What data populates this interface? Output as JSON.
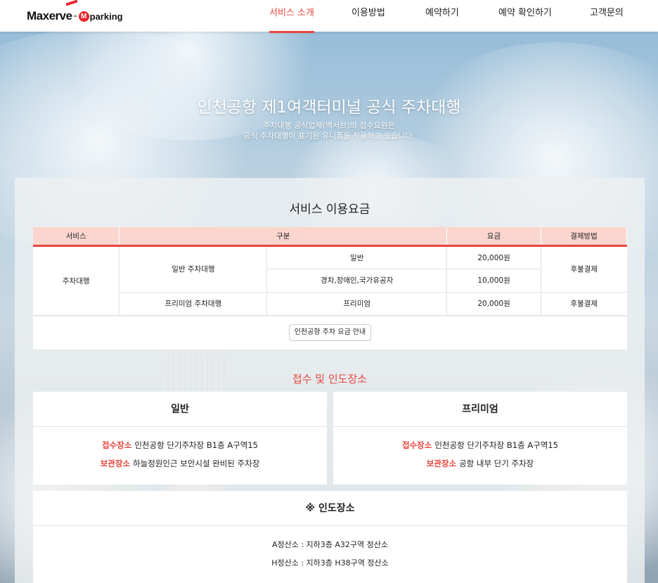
{
  "brand": {
    "logo_maxerve": "Maxerve",
    "logo_dash": "-",
    "logo_m": "M",
    "logo_parking": "parking"
  },
  "nav": {
    "items": [
      {
        "label": "서비스 소개"
      },
      {
        "label": "이용방법"
      },
      {
        "label": "예약하기"
      },
      {
        "label": "예약 확인하기"
      },
      {
        "label": "고객문의"
      }
    ],
    "active_index": 0
  },
  "hero": {
    "title": "인천공항 제1여객터미널 공식 주차대행",
    "subtitle_line1": "주차대행 공식업체(맥서브)의 접수요원은",
    "subtitle_line2": "공식 주차대행이 표기된 유니폼을 착용하고 있습니다."
  },
  "fees": {
    "title": "서비스 이용요금",
    "headers": {
      "service": "서비스",
      "category": "구분",
      "fee": "요금",
      "payment": "결제방법"
    },
    "service_name": "주차대행",
    "general_name": "일반 주차대행",
    "premium_name": "프리미엄 주차대행",
    "rows": {
      "general_normal": {
        "type": "일반",
        "fee": "20,000원"
      },
      "general_discount": {
        "type": "경차,장애인,국가유공자",
        "fee": "10,000원"
      },
      "premium": {
        "type": "프리미엄",
        "fee": "20,000원"
      }
    },
    "payment_general": "후불결제",
    "payment_premium": "후불결제",
    "guide_button": "인천공항 주차 요금 안내"
  },
  "locations": {
    "title": "접수 및 인도장소",
    "general": {
      "heading": "일반",
      "reception_label": "접수장소",
      "reception_value": "인천공항 단기주차장 B1층 A구역15",
      "storage_label": "보관장소",
      "storage_value": "하늘정원인근 보안시설 완비된 주차장"
    },
    "premium": {
      "heading": "프리미엄",
      "reception_label": "접수장소",
      "reception_value": "인천공항 단기주차장 B1층 A구역15",
      "storage_label": "보관장소",
      "storage_value": "공항 내부 단기 주차장"
    },
    "delivery": {
      "heading": "※ 인도장소",
      "line1": "A정산소 : 지하3층 A32구역 정산소",
      "line2": "H정산소 : 지하3층 H38구역 정산소"
    }
  },
  "colors": {
    "accent": "#e8453c",
    "table_header": "#fbd6cf",
    "brand_red": "#e8232f"
  }
}
